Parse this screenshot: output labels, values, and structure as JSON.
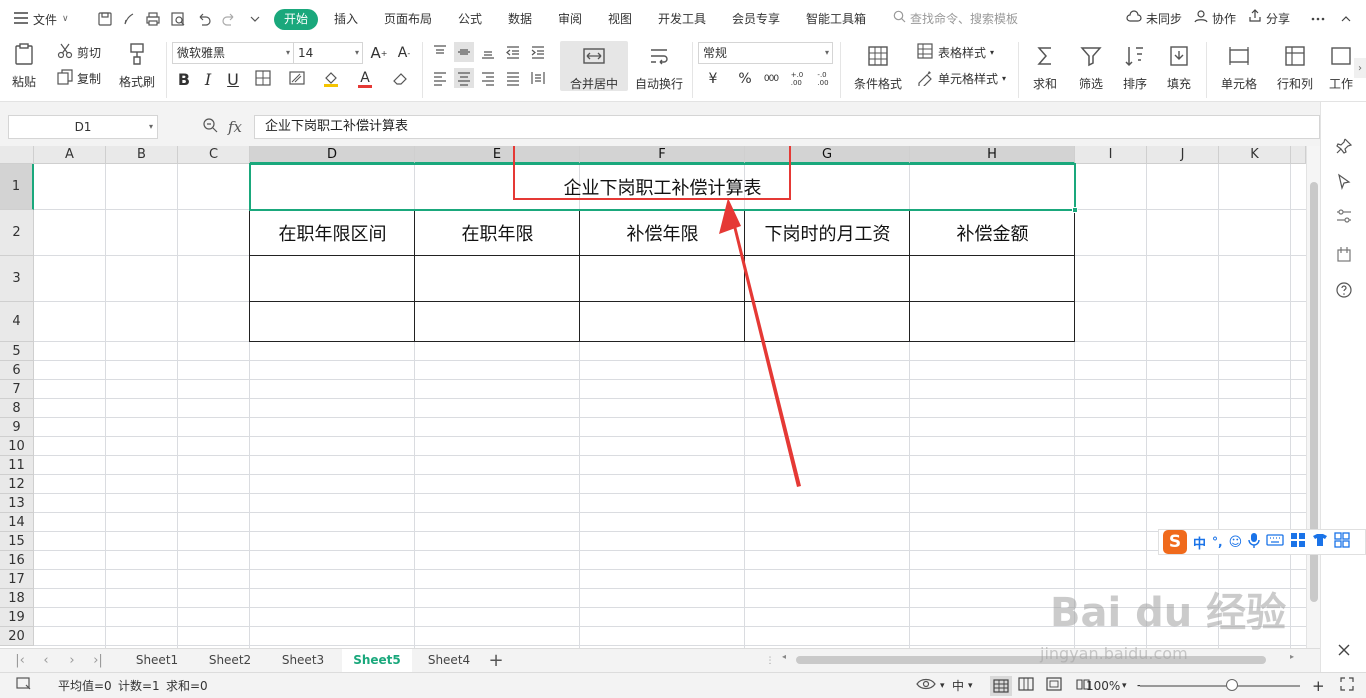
{
  "menu": {
    "file_label": "文件",
    "tabs": [
      "开始",
      "插入",
      "页面布局",
      "公式",
      "数据",
      "审阅",
      "视图",
      "开发工具",
      "会员专享",
      "智能工具箱"
    ],
    "search_placeholder": "查找命令、搜索模板",
    "sync_label": "未同步",
    "collab_label": "协作",
    "share_label": "分享"
  },
  "ribbon": {
    "paste": "粘贴",
    "cut": "剪切",
    "copy": "复制",
    "format_painter": "格式刷",
    "font_name": "微软雅黑",
    "font_size": "14",
    "merge_center": "合并居中",
    "wrap_text": "自动换行",
    "number_format": "常规",
    "conditional_format": "条件格式",
    "table_style": "表格样式",
    "cell_style": "单元格样式",
    "sum": "求和",
    "filter": "筛选",
    "sort": "排序",
    "fill": "填充",
    "cell": "单元格",
    "row_col": "行和列",
    "worksheet": "工作",
    "bold": "B",
    "italic": "I",
    "underline": "U",
    "percent": "%",
    "currency": "¥",
    "thousands": "000",
    "dec_inc": "+.0\n.00",
    "dec_dec": "-.0\n.00"
  },
  "formula_bar": {
    "name_box": "D1",
    "fx": "fx",
    "content": "企业下岗职工补偿计算表"
  },
  "grid": {
    "columns": [
      "A",
      "B",
      "C",
      "D",
      "E",
      "F",
      "G",
      "H",
      "I",
      "J",
      "K"
    ],
    "rows": [
      "1",
      "2",
      "3",
      "4",
      "5",
      "6",
      "7",
      "8",
      "9",
      "10",
      "11",
      "12",
      "13",
      "14",
      "15",
      "16",
      "17",
      "18",
      "19",
      "20"
    ],
    "title": "企业下岗职工补偿计算表",
    "headers": [
      "在职年限区间",
      "在职年限",
      "补偿年限",
      "下岗时的月工资",
      "补偿金额"
    ]
  },
  "sheets": [
    "Sheet1",
    "Sheet2",
    "Sheet3",
    "Sheet5",
    "Sheet4"
  ],
  "active_sheet": "Sheet5",
  "status": {
    "average": "平均值=0",
    "count": "计数=1",
    "sum": "求和=0",
    "zoom": "100%"
  },
  "ime": {
    "label": "中"
  },
  "watermark": {
    "brand": "Bai du 经验",
    "url": "jingyan.baidu.com"
  },
  "colors": {
    "accent": "#1aa87c",
    "annotation": "#e53935"
  }
}
